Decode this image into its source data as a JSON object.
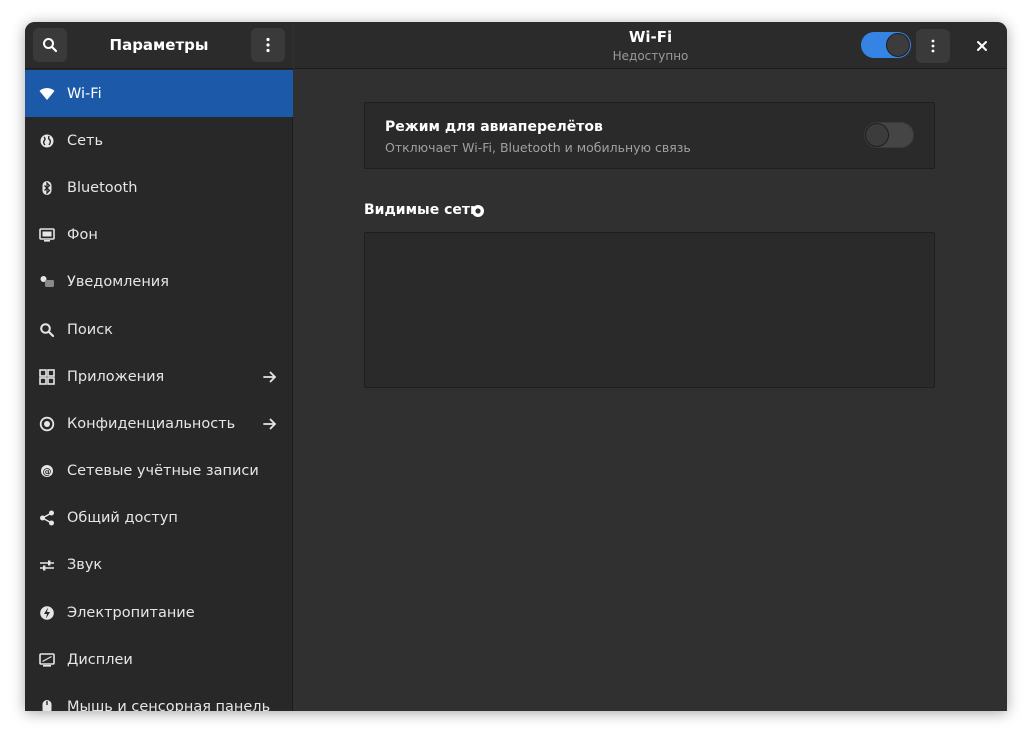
{
  "sidebar": {
    "title": "Параметры",
    "search_icon": "search-icon",
    "menu_icon": "menu-dots-icon",
    "items": [
      {
        "label": "Wi-Fi",
        "icon": "wifi-icon",
        "active": true
      },
      {
        "label": "Сеть",
        "icon": "network-globe-icon"
      },
      {
        "label": "Bluetooth",
        "icon": "bluetooth-icon"
      },
      {
        "label": "Фон",
        "icon": "background-icon"
      },
      {
        "label": "Уведомления",
        "icon": "notifications-icon"
      },
      {
        "label": "Поиск",
        "icon": "search-icon"
      },
      {
        "label": "Приложения",
        "icon": "apps-grid-icon",
        "arrow": true
      },
      {
        "label": "Конфиденциальность",
        "icon": "privacy-icon",
        "arrow": true
      },
      {
        "label": "Сетевые учётные записи",
        "icon": "online-accounts-icon"
      },
      {
        "label": "Общий доступ",
        "icon": "sharing-icon"
      },
      {
        "label": "Звук",
        "icon": "sound-icon"
      },
      {
        "label": "Электропитание",
        "icon": "power-icon"
      },
      {
        "label": "Дисплеи",
        "icon": "display-icon"
      },
      {
        "label": "Мышь и сенсорная панель",
        "icon": "mouse-icon"
      }
    ]
  },
  "header": {
    "title": "Wi-Fi",
    "subtitle": "Недоступно",
    "wifi_toggle_on": true,
    "accent_color": "#3584e4"
  },
  "airplane": {
    "title": "Режим для авиаперелётов",
    "description": "Отключает Wi-Fi, Bluetooth и мобильную связь",
    "enabled": false
  },
  "networks": {
    "heading": "Видимые сети"
  },
  "colors": {
    "selection": "#1c59a8",
    "window_bg": "#303030",
    "sidebar_bg": "#282828"
  }
}
